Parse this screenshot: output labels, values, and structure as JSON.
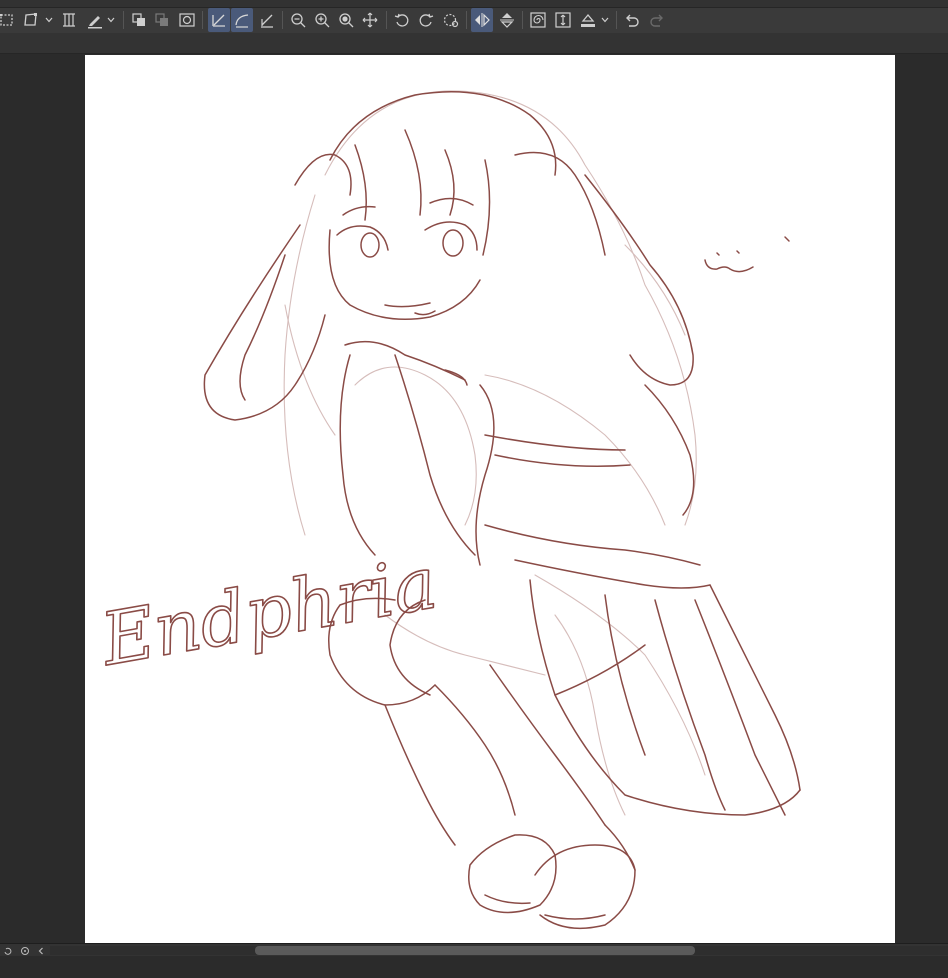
{
  "toolbar": {
    "buttons": [
      {
        "id": "select-rect",
        "icon": "rect-select-icon"
      },
      {
        "id": "transform",
        "icon": "free-transform-icon"
      },
      {
        "id": "mesh-transform",
        "icon": "mesh-transform-icon"
      },
      {
        "id": "pen-settings",
        "icon": "pen-icon"
      },
      {
        "id": "copy-layer",
        "icon": "copy-layer-icon"
      },
      {
        "id": "paste-layer",
        "icon": "paste-layer-icon"
      },
      {
        "id": "layer-frame",
        "icon": "layer-frame-icon"
      },
      {
        "id": "ruler-snap",
        "icon": "snap-ruler-icon",
        "active": true
      },
      {
        "id": "curve-snap",
        "icon": "snap-curve-icon",
        "active": true
      },
      {
        "id": "special-ruler",
        "icon": "special-ruler-icon"
      },
      {
        "id": "zoom-out",
        "icon": "zoom-out-icon"
      },
      {
        "id": "zoom-in",
        "icon": "zoom-in-icon"
      },
      {
        "id": "zoom-fit",
        "icon": "zoom-fit-icon"
      },
      {
        "id": "move-view",
        "icon": "move-view-icon"
      },
      {
        "id": "rotate-left",
        "icon": "rotate-left-icon"
      },
      {
        "id": "rotate-right",
        "icon": "rotate-right-icon"
      },
      {
        "id": "rotate-reset",
        "icon": "rotate-reset-icon"
      },
      {
        "id": "flip-horizontal",
        "icon": "flip-horizontal-icon",
        "active": true
      },
      {
        "id": "flip-vertical",
        "icon": "flip-vertical-icon"
      },
      {
        "id": "stabilizer",
        "icon": "spiral-icon"
      },
      {
        "id": "fit-frame",
        "icon": "fit-frame-icon"
      },
      {
        "id": "fill-bucket",
        "icon": "bucket-icon"
      },
      {
        "id": "undo",
        "icon": "undo-icon"
      },
      {
        "id": "redo",
        "icon": "redo-icon"
      }
    ]
  },
  "canvas": {
    "signature": "Endphria",
    "line_color": "#7a3a36",
    "sketch_color": "#c9a9a6",
    "background": "#ffffff"
  },
  "colors": {
    "ui_dark": "#2b2b2b",
    "toolbar": "#3a3a3a",
    "active_highlight": "#4a5a7a"
  }
}
